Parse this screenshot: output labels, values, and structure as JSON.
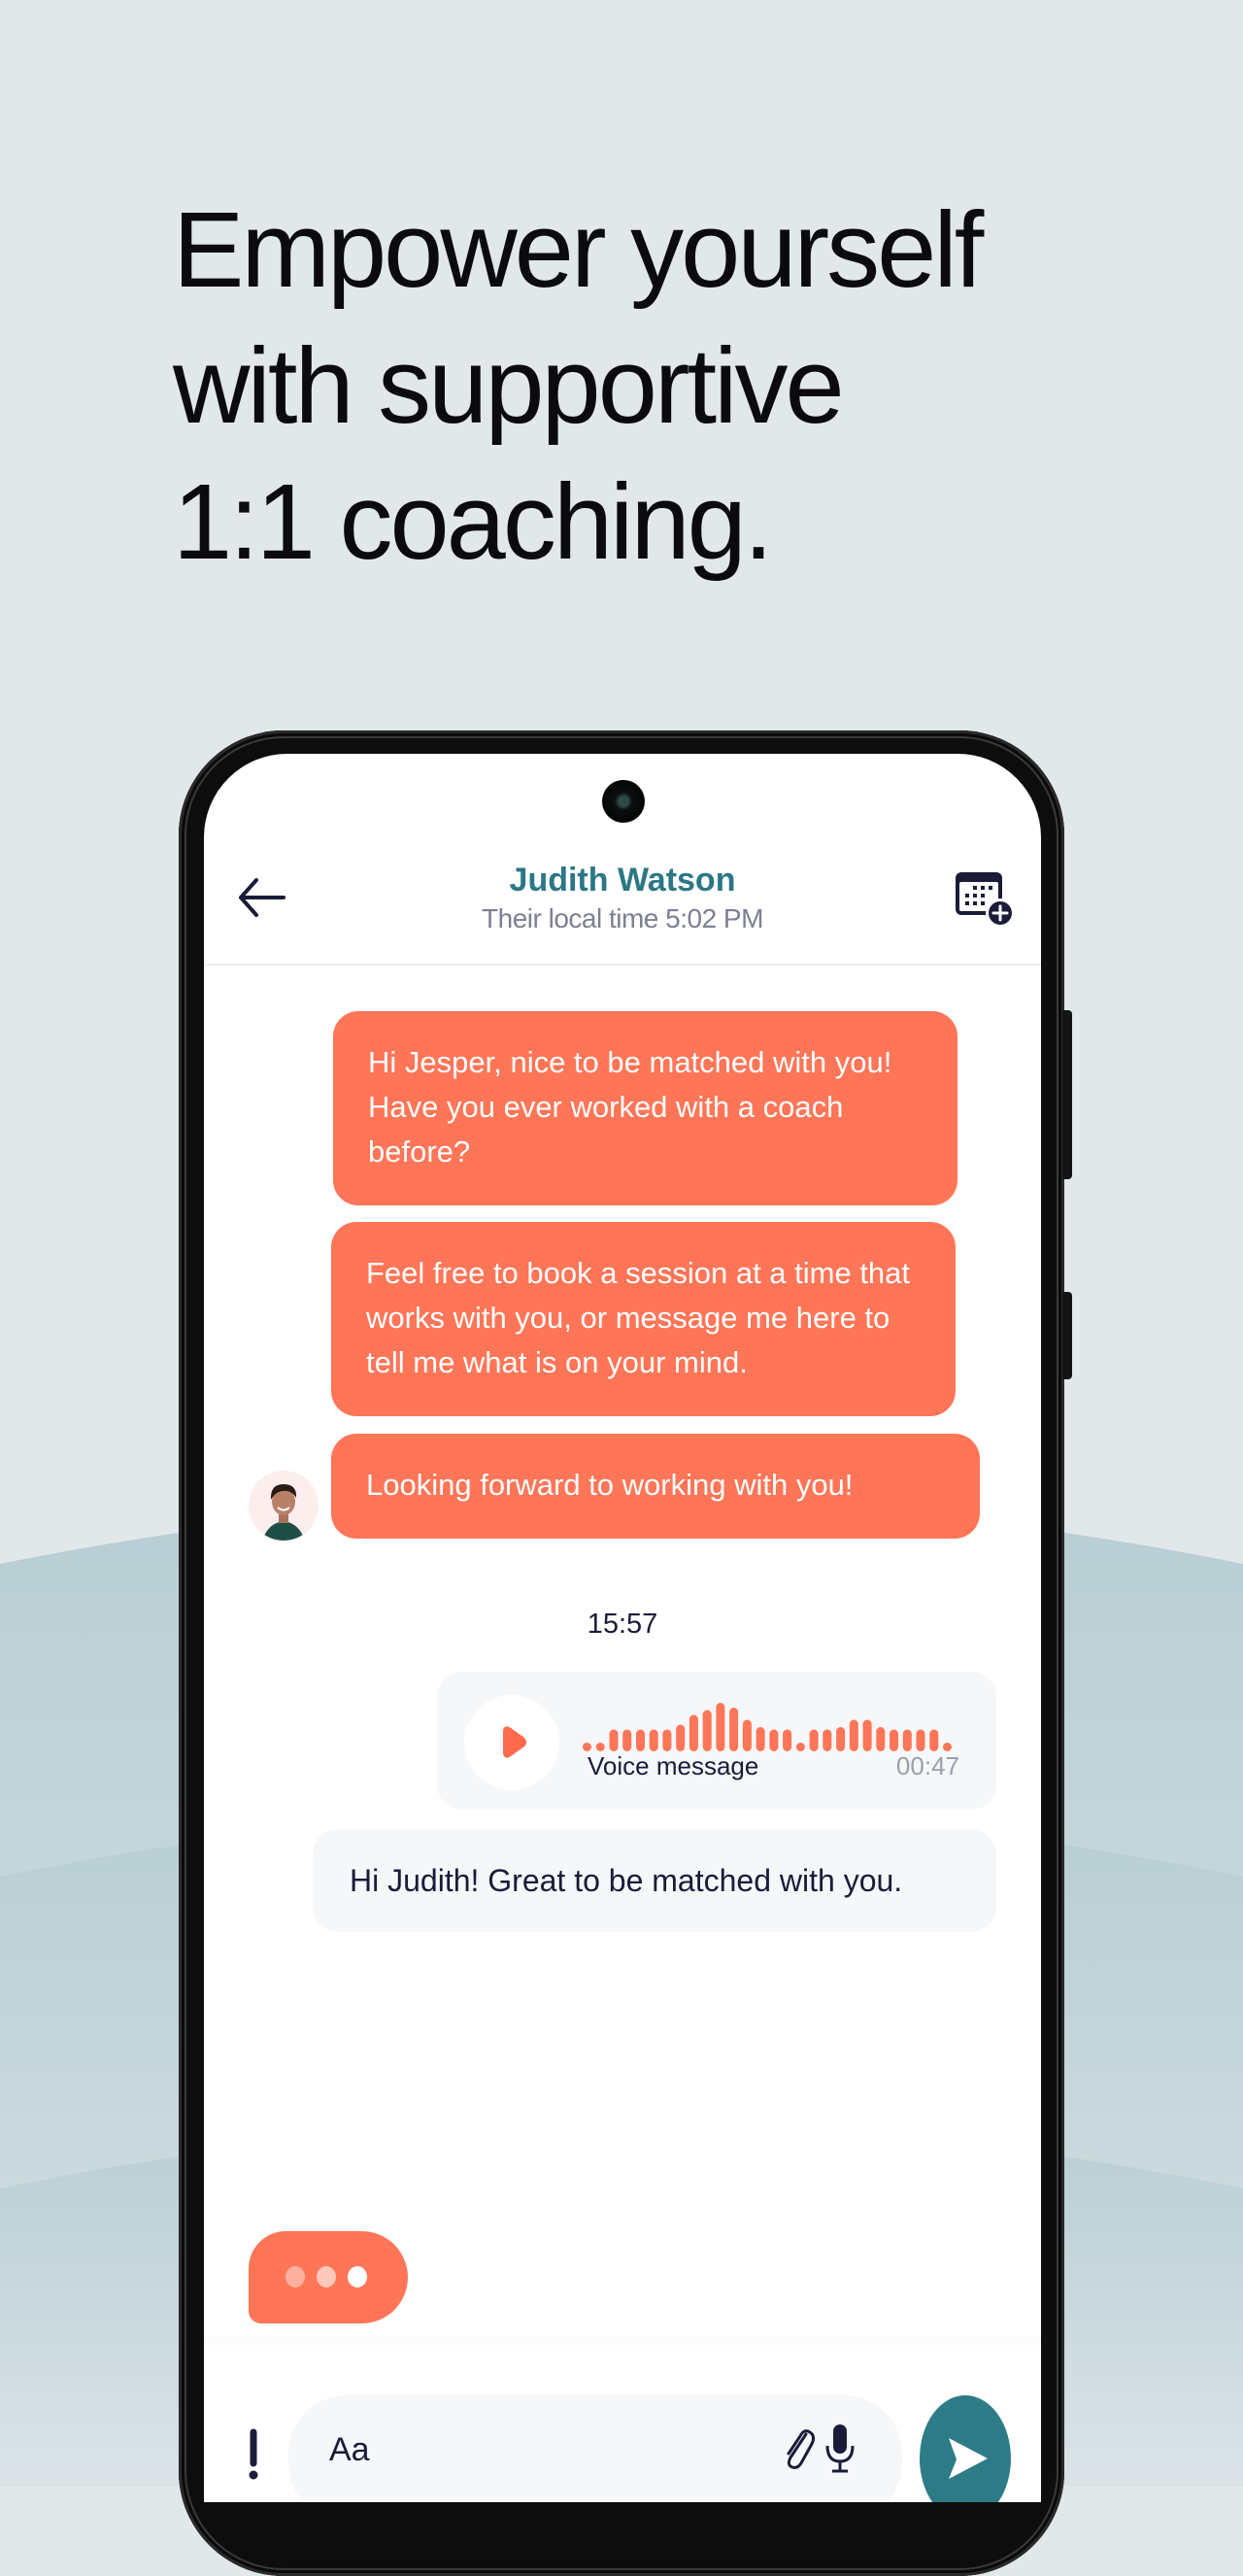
{
  "colors": {
    "accent_coral": "#ff7557",
    "accent_teal": "#2b7785",
    "send_button": "#2e7b88",
    "text_dark": "#1b1b3a",
    "text_muted": "#7d7f92",
    "bubble_light": "#f5f7f9",
    "background": "#e2e8ea"
  },
  "headline": {
    "lines": [
      "Empower yourself",
      "with supportive",
      "1:1 coaching."
    ]
  },
  "chat_header": {
    "back_icon": "arrow-left-icon",
    "name": "Judith Watson",
    "subtitle": "Their local time 5:02 PM",
    "calendar_icon": "calendar-plus-icon"
  },
  "messages": [
    {
      "sender": "coach",
      "text": "Hi Jesper, nice to be matched with you! Have you ever worked with a coach before?"
    },
    {
      "sender": "coach",
      "text": "Feel free to book a session at a time that works with you, or message me here to tell me what is on your mind."
    },
    {
      "sender": "coach",
      "text": "Looking forward to working with you!",
      "avatar": "coach-avatar"
    }
  ],
  "timestamp": "15:57",
  "voice_message": {
    "label": "Voice message",
    "duration": "00:47",
    "play_icon": "play-icon",
    "waveform_levels": [
      0.1,
      0.1,
      0.45,
      0.45,
      0.45,
      0.45,
      0.45,
      0.55,
      0.75,
      0.85,
      1.0,
      0.9,
      0.65,
      0.5,
      0.45,
      0.45,
      0.1,
      0.45,
      0.45,
      0.5,
      0.65,
      0.65,
      0.5,
      0.45,
      0.45,
      0.45,
      0.45,
      0.1
    ]
  },
  "user_message": {
    "sender": "user",
    "text": "Hi Judith! Great to be matched with you."
  },
  "typing_indicator": {
    "dots": 3
  },
  "composer": {
    "alert_icon": "exclamation-icon",
    "placeholder": "Aa",
    "attach_icon": "paperclip-icon",
    "mic_icon": "microphone-icon",
    "send_icon": "send-icon"
  }
}
